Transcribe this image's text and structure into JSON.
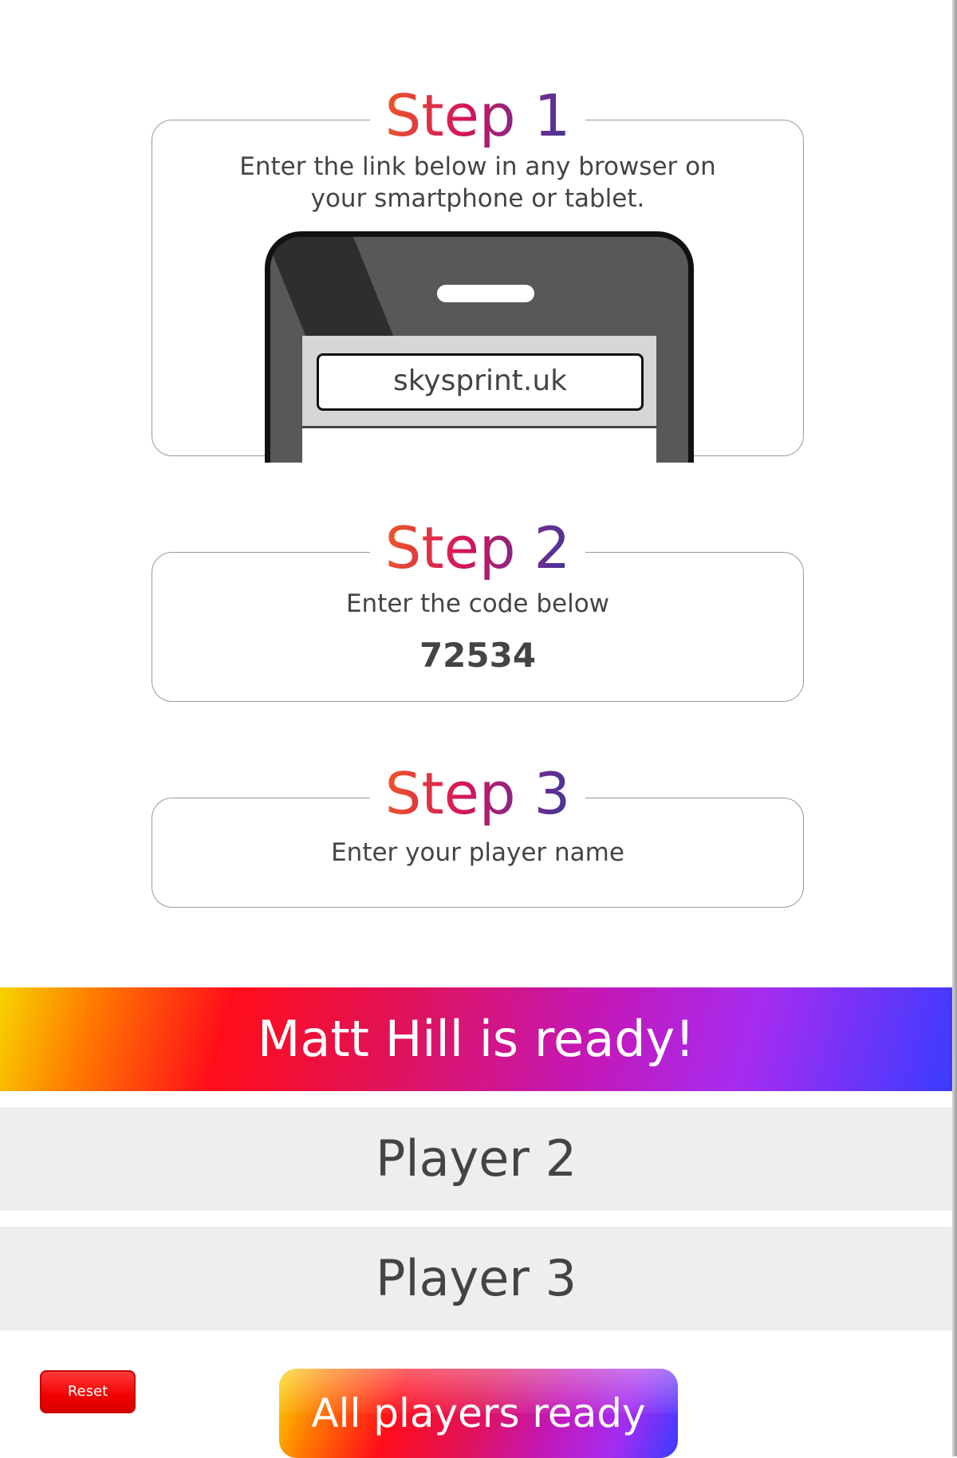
{
  "steps": [
    {
      "title": "Step 1",
      "text_line1": "Enter the link below in any browser on",
      "text_line2": "your smartphone or tablet."
    },
    {
      "title": "Step 2",
      "text": "Enter the code below",
      "code": "72534"
    },
    {
      "title": "Step 3",
      "text": "Enter your player name"
    }
  ],
  "phone": {
    "url": "skysprint.uk"
  },
  "players": [
    {
      "label": "Matt Hill is ready!",
      "ready": true
    },
    {
      "label": "Player 2",
      "ready": false
    },
    {
      "label": "Player 3",
      "ready": false
    }
  ],
  "buttons": {
    "reset_label": "Reset",
    "all_ready_label": "All players ready"
  },
  "colors": {
    "reset": "#f20000",
    "text": "#444444",
    "empty_slot": "#eeeeee"
  },
  "icons": {
    "phone": "smartphone-illustration"
  }
}
